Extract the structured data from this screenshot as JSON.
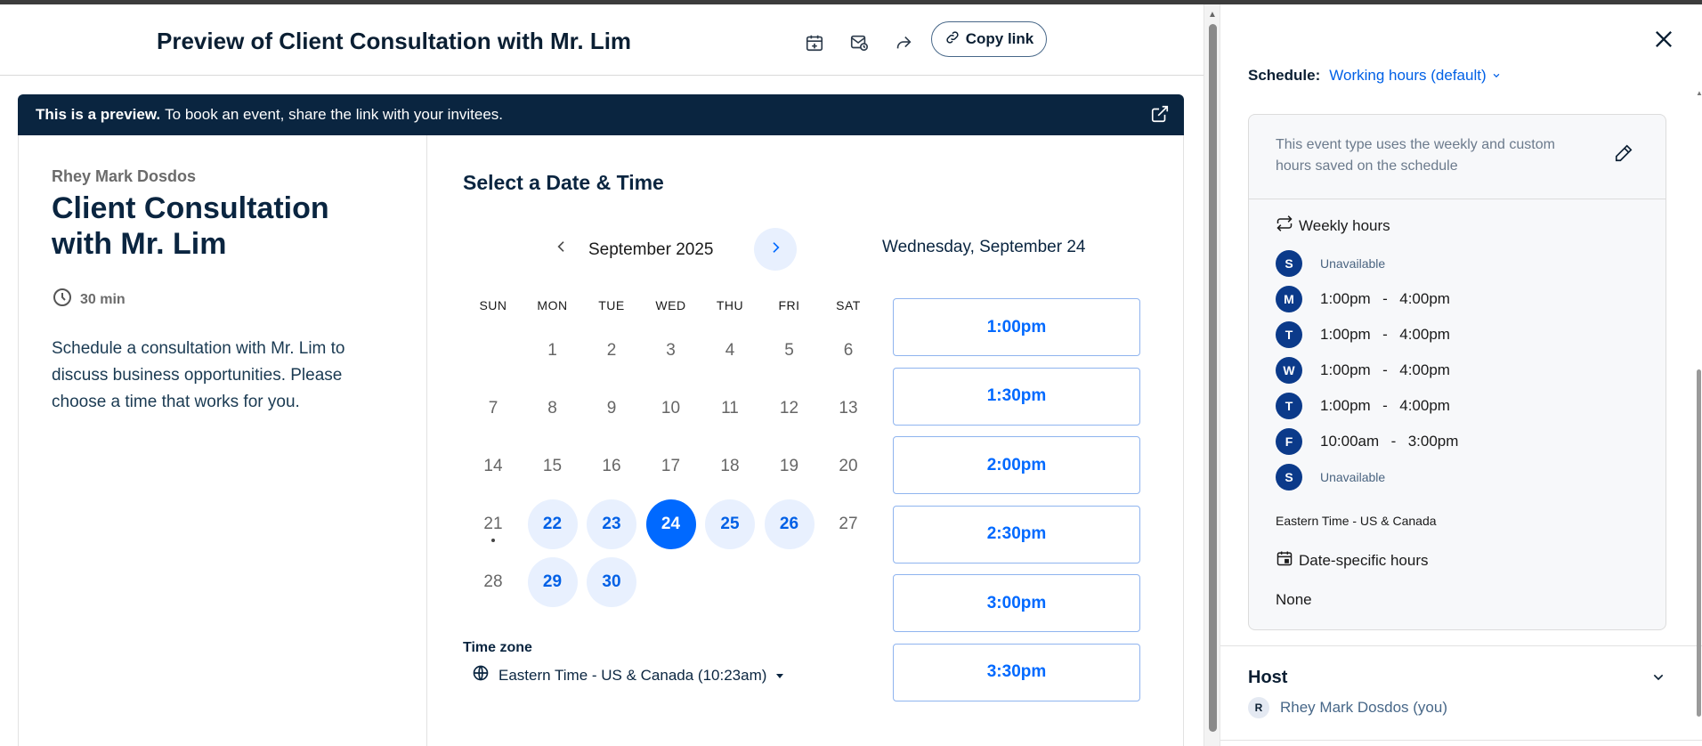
{
  "header": {
    "title": "Preview of Client Consultation with Mr. Lim",
    "copy_link_label": "Copy link",
    "icons": [
      "calendar-add-icon",
      "email-schedule-icon",
      "share-icon",
      "link-icon"
    ]
  },
  "banner": {
    "bold": "This is a preview.",
    "text": "To book an event, share the link with your invitees."
  },
  "event": {
    "organizer": "Rhey Mark Dosdos",
    "name": "Client Consultation with Mr. Lim",
    "duration": "30 min",
    "description": "Schedule a consultation with Mr. Lim to discuss business opportunities. Please choose a time that works for you."
  },
  "calendar": {
    "heading": "Select a Date & Time",
    "month": "September 2025",
    "weekdays": [
      "SUN",
      "MON",
      "TUE",
      "WED",
      "THU",
      "FRI",
      "SAT"
    ],
    "weeks": [
      [
        {
          "d": ""
        },
        {
          "d": "1"
        },
        {
          "d": "2"
        },
        {
          "d": "3"
        },
        {
          "d": "4"
        },
        {
          "d": "5"
        },
        {
          "d": "6"
        }
      ],
      [
        {
          "d": "7"
        },
        {
          "d": "8"
        },
        {
          "d": "9"
        },
        {
          "d": "10"
        },
        {
          "d": "11"
        },
        {
          "d": "12"
        },
        {
          "d": "13"
        }
      ],
      [
        {
          "d": "14"
        },
        {
          "d": "15"
        },
        {
          "d": "16"
        },
        {
          "d": "17"
        },
        {
          "d": "18"
        },
        {
          "d": "19"
        },
        {
          "d": "20"
        }
      ],
      [
        {
          "d": "21",
          "today": true
        },
        {
          "d": "22",
          "avail": true
        },
        {
          "d": "23",
          "avail": true
        },
        {
          "d": "24",
          "selected": true
        },
        {
          "d": "25",
          "avail": true
        },
        {
          "d": "26",
          "avail": true
        },
        {
          "d": "27"
        }
      ],
      [
        {
          "d": "28"
        },
        {
          "d": "29",
          "avail": true
        },
        {
          "d": "30",
          "avail": true
        }
      ]
    ],
    "timezone_label": "Time zone",
    "timezone_value": "Eastern Time - US & Canada (10:23am)"
  },
  "slots": {
    "date_heading": "Wednesday, September 24",
    "times": [
      "1:00pm",
      "1:30pm",
      "2:00pm",
      "2:30pm",
      "3:00pm",
      "3:30pm"
    ]
  },
  "side": {
    "schedule_label": "Schedule:",
    "schedule_value": "Working hours (default)",
    "info_text": "This event type uses the weekly and custom hours saved on the schedule",
    "weekly_label": "Weekly hours",
    "days": [
      {
        "letter": "S",
        "hours": "Unavailable",
        "unavailable": true
      },
      {
        "letter": "M",
        "hours": "1:00pm  -  4:00pm"
      },
      {
        "letter": "T",
        "hours": "1:00pm  -  4:00pm"
      },
      {
        "letter": "W",
        "hours": "1:00pm  -  4:00pm"
      },
      {
        "letter": "T",
        "hours": "1:00pm  -  4:00pm"
      },
      {
        "letter": "F",
        "hours": "10:00am  -  3:00pm"
      },
      {
        "letter": "S",
        "hours": "Unavailable",
        "unavailable": true
      }
    ],
    "timezone": "Eastern Time - US & Canada",
    "date_specific_label": "Date-specific hours",
    "date_specific_value": "None",
    "host_title": "Host",
    "host_initial": "R",
    "host_name": "Rhey Mark Dosdos (you)"
  },
  "colors": {
    "accent": "#0069ff",
    "navy": "#0a2540",
    "available_bg": "#e8f0fe"
  }
}
